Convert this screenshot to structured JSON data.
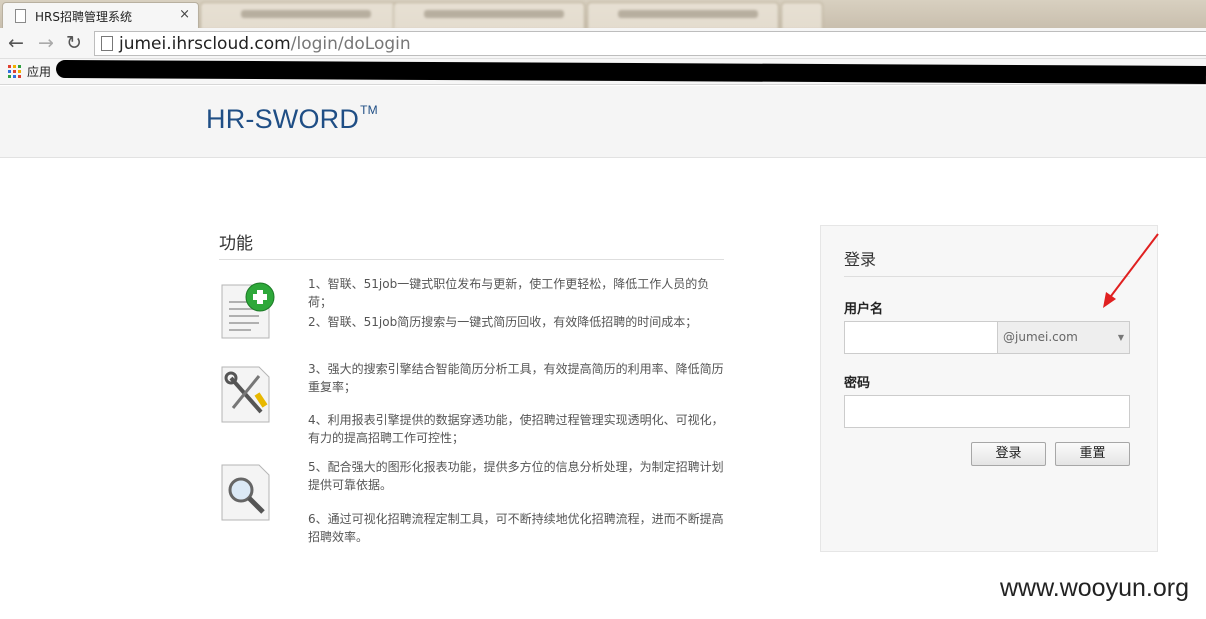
{
  "browser": {
    "active_tab_title": "HRS招聘管理系统",
    "close_glyph": "×",
    "url_host": "jumei.ihrscloud.com",
    "url_path": "/login/doLogin",
    "apps_label": "应用"
  },
  "header": {
    "brand": "HR-SWORD",
    "trademark": "TM"
  },
  "features": {
    "title": "功能",
    "items": [
      "1、智联、51job一键式职位发布与更新，使工作更轻松，降低工作人员的负荷；",
      "2、智联、51job简历搜索与一键式简历回收，有效降低招聘的时间成本；",
      "3、强大的搜索引擎结合智能简历分析工具，有效提高简历的利用率、降低简历重复率；",
      "4、利用报表引擎提供的数据穿透功能，使招聘过程管理实现透明化、可视化，有力的提高招聘工作可控性；",
      "5、配合强大的图形化报表功能，提供多方位的信息分析处理，为制定招聘计划提供可靠依据。",
      "6、通过可视化招聘流程定制工具，可不断持续地优化招聘流程，进而不断提高招聘效率。"
    ],
    "icons": [
      "document-add-icon",
      "tools-icon",
      "magnifier-icon"
    ]
  },
  "login": {
    "title": "登录",
    "username_label": "用户名",
    "username_value": "",
    "domain_selected": "@jumei.com",
    "password_label": "密码",
    "password_value": "",
    "login_button": "登录",
    "reset_button": "重置"
  },
  "watermark": "www.wooyun.org",
  "colors": {
    "brand": "#1f4e85",
    "arrow": "#e02020"
  }
}
